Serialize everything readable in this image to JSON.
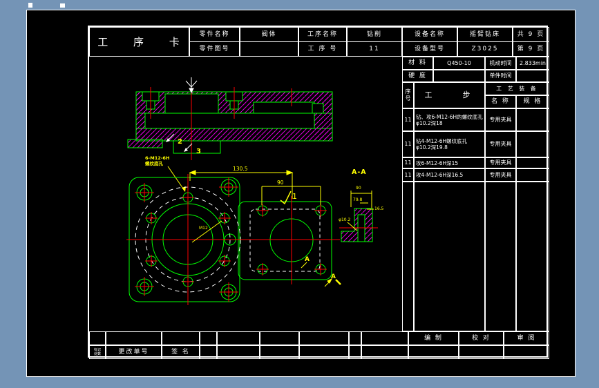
{
  "header": {
    "title": "工 序 卡",
    "part_name_label": "零件名称",
    "part_name": "阀体",
    "part_no_label": "零件图号",
    "part_no": "",
    "process_name_label": "工序名称",
    "process_name": "钻削",
    "process_no_label": "工 序 号",
    "process_no": "11",
    "equip_name_label": "设备名称",
    "equip_name": "摇臂钻床",
    "equip_model_label": "设备型号",
    "equip_model": "Z3025",
    "pages_total": "共 9 页",
    "page_current": "第 9 页"
  },
  "info": {
    "material_label": "材 料",
    "material": "Q450-10",
    "machine_time_label": "机动时间",
    "machine_time": "2.833min",
    "hardness_label": "硬 度",
    "hardness": "",
    "unit_time_label": "单件时间",
    "unit_time": ""
  },
  "steps": {
    "seq_label": "序\n号",
    "step_label": "工    步",
    "tooling_label": "工 艺 装 备",
    "name_label": "名 称",
    "spec_label": "规 格",
    "rows": [
      {
        "no": "11",
        "step": "钻、攻6-M12-6H的螺纹底孔 φ10.2深18",
        "tool": "专用夹具",
        "spec": ""
      },
      {
        "no": "11",
        "step": "钻4-M12-6H螺纹底孔 φ10.2深19.8",
        "tool": "专用夹具",
        "spec": ""
      },
      {
        "no": "11",
        "step": "攻6-M12-6H深15",
        "tool": "专用夹具",
        "spec": ""
      },
      {
        "no": "11",
        "step": "攻4-M12-6H深16.5",
        "tool": "专用夹具",
        "spec": ""
      }
    ]
  },
  "footer": {
    "mark_label": "标记\n处数",
    "change_label": "更改单号",
    "sign_label": "签 名",
    "compile_label": "编 制",
    "check_label": "校 对",
    "review_label": "审 阅"
  },
  "drawing": {
    "dims": {
      "width_dim": "130.5",
      "plate_dim": "90",
      "step_ref": "1",
      "callout_2": "2",
      "callout_3": "3",
      "thread_note_1": "6-M12-6H",
      "thread_note_2": "螺纹底孔",
      "hole_note": "M12",
      "section_title": "A-A",
      "section_mark_1": "A",
      "section_mark_2": "A",
      "aa_top": "90",
      "aa_mid": "79.8",
      "aa_right": "16.5",
      "aa_left": "φ10.2"
    },
    "colors": {
      "geometry": "#00ff00",
      "hatch": "#dd00dd",
      "centerline": "#ff0000",
      "dimension": "#ffff00",
      "hidden": "#ffffff",
      "background": "#7494b6"
    }
  }
}
